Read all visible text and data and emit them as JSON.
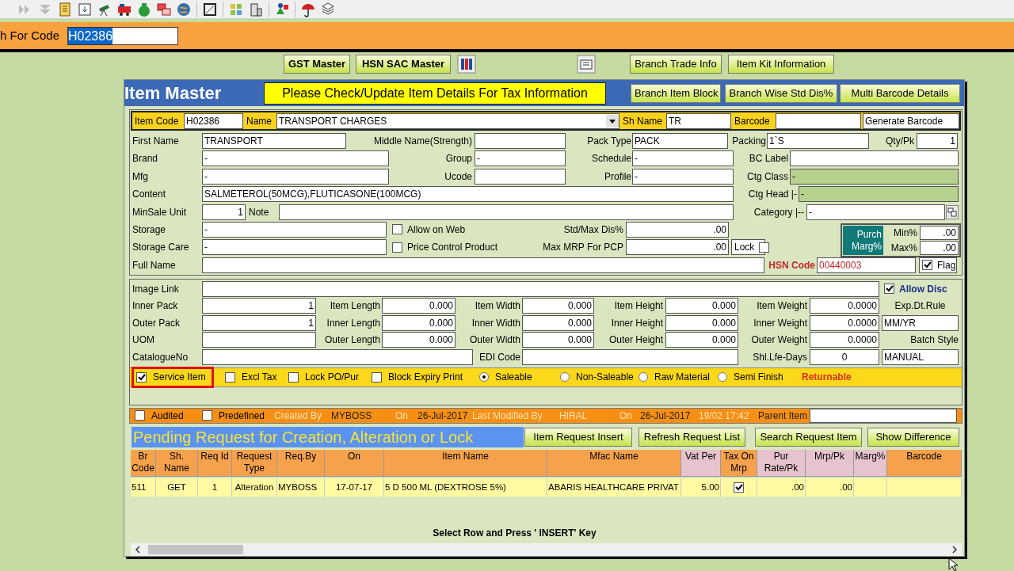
{
  "search_bar": {
    "label": "h For Code",
    "value": "H02386"
  },
  "top_buttons": [
    "GST Master",
    "HSN SAC Master",
    "Branch Trade Info",
    "Item Kit Information"
  ],
  "window": {
    "title": "Item Master",
    "notice": "Please Check/Update Item Details For Tax Information",
    "buttons": [
      "Branch Item Block",
      "Branch Wise Std Dis%",
      "Multi Barcode Details"
    ]
  },
  "header_row": [
    {
      "kind": "label",
      "text": "Item Code"
    },
    {
      "kind": "field",
      "value": "H02386"
    },
    {
      "kind": "label",
      "text": "Name"
    },
    {
      "kind": "dropdown",
      "value": "TRANSPORT CHARGES"
    },
    {
      "kind": "label",
      "text": "Sh Name"
    },
    {
      "kind": "field",
      "value": "TR"
    },
    {
      "kind": "label",
      "text": "Barcode"
    },
    {
      "kind": "field"
    },
    {
      "kind": "button",
      "text": "Generate Barcode"
    }
  ],
  "form_rows": [
    [
      {
        "kind": "label",
        "text": "First Name"
      },
      {
        "kind": "field",
        "value": "TRANSPORT"
      },
      {
        "kind": "label",
        "text": "Middle Name(Strength)"
      },
      {
        "kind": "field"
      },
      {
        "kind": "label",
        "text": "Pack Type"
      },
      {
        "kind": "field",
        "value": "PACK"
      },
      {
        "kind": "label",
        "text": "Packing"
      },
      {
        "kind": "field",
        "value": "1`S"
      },
      {
        "kind": "label",
        "text": "Qty/Pk"
      },
      {
        "kind": "numeric",
        "value": "1"
      }
    ],
    [
      {
        "kind": "label",
        "text": "Brand"
      },
      {
        "kind": "field",
        "value": "-"
      },
      {
        "kind": "label",
        "text": "Group"
      },
      {
        "kind": "field",
        "value": "-"
      },
      {
        "kind": "label",
        "text": "Schedule"
      },
      {
        "kind": "field",
        "value": "-"
      },
      {
        "kind": "label",
        "text": "BC Label"
      },
      {
        "kind": "field"
      }
    ],
    [
      {
        "kind": "label",
        "text": "Mfg"
      },
      {
        "kind": "field",
        "value": "-"
      },
      {
        "kind": "label",
        "text": "Ucode"
      },
      {
        "kind": "field"
      },
      {
        "kind": "label",
        "text": "Profile"
      },
      {
        "kind": "field",
        "value": "-"
      },
      {
        "kind": "label",
        "text": "Ctg Class"
      },
      {
        "kind": "locked",
        "value": "-"
      }
    ],
    [
      {
        "kind": "label",
        "text": "Content"
      },
      {
        "kind": "field",
        "value": "SALMETEROL(50MCG),FLUTICASONE(100MCG)"
      },
      {
        "kind": "label",
        "text": "Ctg Head |-"
      },
      {
        "kind": "locked",
        "value": "-"
      }
    ],
    [
      {
        "kind": "label",
        "text": "MinSale Unit"
      },
      {
        "kind": "numeric",
        "value": "1"
      },
      {
        "kind": "label",
        "text": "Note"
      },
      {
        "kind": "field"
      },
      {
        "kind": "label",
        "text": "Category |--"
      },
      {
        "kind": "picker",
        "value": "-"
      }
    ],
    [
      {
        "kind": "label",
        "text": "Storage"
      },
      {
        "kind": "field",
        "value": "-"
      },
      {
        "kind": "checkbox",
        "text": "Allow on Web",
        "checked": false
      },
      {
        "kind": "label",
        "text": "Std/Max Dis%"
      },
      {
        "kind": "numeric",
        "value": ".00"
      }
    ],
    [
      {
        "kind": "label",
        "text": "Storage Care"
      },
      {
        "kind": "field",
        "value": "-"
      },
      {
        "kind": "checkbox",
        "text": "Price Control Product",
        "checked": false
      },
      {
        "kind": "label",
        "text": "Max MRP For PCP"
      },
      {
        "kind": "numeric",
        "value": ".00"
      },
      {
        "kind": "lock",
        "text": "Lock",
        "checked": false
      }
    ],
    [
      {
        "kind": "label",
        "text": "Full Name"
      },
      {
        "kind": "field"
      },
      {
        "kind": "alert_label",
        "text": "HSN Code"
      },
      {
        "kind": "alert_field",
        "value": "00440003"
      },
      {
        "kind": "boxed_checkbox",
        "text": "Flag",
        "checked": true
      }
    ]
  ],
  "purchase_margin": {
    "title": "Purch Marg%",
    "min_label": "Min%",
    "min": ".00",
    "max_label": "Max%",
    "max": ".00"
  },
  "dimension_rows": [
    [
      {
        "kind": "label",
        "text": "Image Link"
      },
      {
        "kind": "field"
      },
      {
        "kind": "bold_checkbox",
        "text": "Allow Disc",
        "checked": true
      }
    ],
    [
      {
        "kind": "label",
        "text": "Inner Pack"
      },
      {
        "kind": "numeric",
        "value": "1"
      },
      {
        "kind": "label",
        "text": "Item Length"
      },
      {
        "kind": "numeric",
        "value": "0.000"
      },
      {
        "kind": "label",
        "text": "Item Width"
      },
      {
        "kind": "numeric",
        "value": "0.000"
      },
      {
        "kind": "label",
        "text": "Item Height"
      },
      {
        "kind": "numeric",
        "value": "0.000"
      },
      {
        "kind": "label",
        "text": "Item Weight"
      },
      {
        "kind": "numeric",
        "value": "0.0000"
      },
      {
        "kind": "label",
        "text": "Exp.Dt.Rule"
      }
    ],
    [
      {
        "kind": "label",
        "text": "Outer Pack"
      },
      {
        "kind": "numeric",
        "value": "1"
      },
      {
        "kind": "label",
        "text": "Inner Length"
      },
      {
        "kind": "numeric",
        "value": "0.000"
      },
      {
        "kind": "label",
        "text": "Inner Width"
      },
      {
        "kind": "numeric",
        "value": "0.000"
      },
      {
        "kind": "label",
        "text": "Inner Height"
      },
      {
        "kind": "numeric",
        "value": "0.000"
      },
      {
        "kind": "label",
        "text": "Inner Weight"
      },
      {
        "kind": "numeric",
        "value": "0.0000"
      },
      {
        "kind": "field",
        "value": "MM/YR"
      }
    ],
    [
      {
        "kind": "label",
        "text": "UOM"
      },
      {
        "kind": "field"
      },
      {
        "kind": "label",
        "text": "Outer Length"
      },
      {
        "kind": "numeric",
        "value": "0.000"
      },
      {
        "kind": "label",
        "text": "Outer Width"
      },
      {
        "kind": "numeric",
        "value": "0.000"
      },
      {
        "kind": "label",
        "text": "Outer Height"
      },
      {
        "kind": "numeric",
        "value": "0.000"
      },
      {
        "kind": "label",
        "text": "Outer Weight"
      },
      {
        "kind": "numeric",
        "value": "0.0000"
      },
      {
        "kind": "label",
        "text": "Batch Style"
      }
    ],
    [
      {
        "kind": "label",
        "text": "CatalogueNo"
      },
      {
        "kind": "field"
      },
      {
        "kind": "label",
        "text": "EDI Code"
      },
      {
        "kind": "field"
      },
      {
        "kind": "label",
        "text": "Shl.Lfe-Days"
      },
      {
        "kind": "centered",
        "value": "0"
      },
      {
        "kind": "field",
        "value": "MANUAL"
      }
    ]
  ],
  "options": [
    {
      "kind": "checkbox",
      "text": "Service Item",
      "checked": true,
      "highlighted": true
    },
    {
      "kind": "checkbox",
      "text": "Excl Tax",
      "checked": false
    },
    {
      "kind": "checkbox",
      "text": "Lock PO/Pur",
      "checked": false
    },
    {
      "kind": "checkbox",
      "text": "Block Expiry Print",
      "checked": false
    },
    {
      "kind": "radio",
      "text": "Saleable",
      "selected": true
    },
    {
      "kind": "radio",
      "text": "Non-Saleable",
      "selected": false
    },
    {
      "kind": "radio",
      "text": "Raw Material",
      "selected": false
    },
    {
      "kind": "radio",
      "text": "Semi Finish",
      "selected": false
    },
    {
      "kind": "alert_text",
      "text": "Returnable"
    }
  ],
  "audit_bar": [
    {
      "kind": "checkbox",
      "text": "Audited",
      "checked": false
    },
    {
      "kind": "checkbox",
      "text": "Predefined",
      "checked": false
    },
    {
      "kind": "muted",
      "text": "Created By"
    },
    {
      "kind": "text",
      "text": "MYBOSS"
    },
    {
      "kind": "muted",
      "text": "On"
    },
    {
      "kind": "text",
      "text": "26-Jul-2017"
    },
    {
      "kind": "muted",
      "text": "Last Modified By"
    },
    {
      "kind": "muted",
      "text": "HIRAL"
    },
    {
      "kind": "muted",
      "text": "On"
    },
    {
      "kind": "text",
      "text": "26-Jul-2017"
    },
    {
      "kind": "muted",
      "text": "19/02 17:42"
    },
    {
      "kind": "text",
      "text": "Parent Item"
    },
    {
      "kind": "field"
    }
  ],
  "pending": {
    "title": "Pending Request for Creation, Alteration or Lock",
    "buttons": [
      "Item Request Insert",
      "Refresh Request List",
      "Search Request Item",
      "Show Difference"
    ],
    "table": {
      "columns": [
        {
          "label": "Br Code",
          "color": "#f6a24c"
        },
        {
          "label": "Sh. Name",
          "color": "#f6a24c"
        },
        {
          "label": "Req Id",
          "color": "#f6a24c"
        },
        {
          "label": "Request Type",
          "color": "#f6a24c"
        },
        {
          "label": "Req.By",
          "color": "#f6a24c"
        },
        {
          "label": "On",
          "color": "#f6a24c"
        },
        {
          "label": "Item Name",
          "color": "#f6a24c"
        },
        {
          "label": "Mfac Name",
          "color": "#f6a24c"
        },
        {
          "label": "Vat Per",
          "color": "#e6c3cd"
        },
        {
          "label": "Tax On Mrp",
          "color": "#f6a24c"
        },
        {
          "label": "Pur Rate/Pk",
          "color": "#e6c3cd"
        },
        {
          "label": "Mrp/Pk",
          "color": "#e6c3cd"
        },
        {
          "label": "Marg%",
          "color": "#e6c3cd"
        },
        {
          "label": "Barcode",
          "color": "#f6a24c"
        }
      ],
      "rows": [
        {
          "br_code": "511",
          "sh_name": "GET",
          "req_id": "1",
          "request_type": "Alteration",
          "req_by": "MYBOSS",
          "on": "17-07-17",
          "item_name": "5 D 500 ML (DEXTROSE 5%)",
          "mfac_name": "ABARIS HEALTHCARE PRIVAT",
          "vat_per": "5.00",
          "tax_on_mrp": true,
          "pur_rate": ".00",
          "mrp": ".00"
        }
      ]
    },
    "note": "Select Row and Press ' INSERT' Key"
  }
}
